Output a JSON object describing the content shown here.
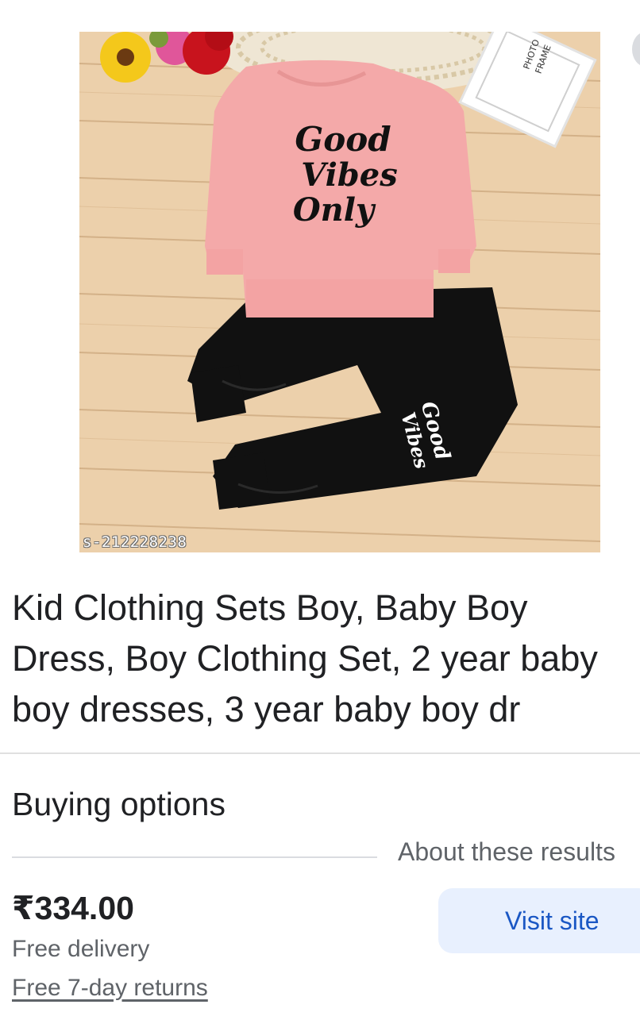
{
  "product": {
    "image_id": "s-212228238",
    "title": "Kid Clothing Sets Boy, Baby Boy Dress, Boy Clothing Set, 2 year baby boy dresses, 3 year baby boy dr",
    "shirt_print": [
      "Good",
      "Vibes",
      "Only"
    ],
    "pants_print": [
      "Good",
      "Vibes"
    ],
    "frame_print": [
      "PHOTO",
      "FRAME"
    ]
  },
  "buying_options": {
    "heading": "Buying options",
    "about_label": "About these results",
    "price": "₹334.00",
    "delivery": "Free delivery",
    "returns": "Free 7-day returns",
    "visit_label": "Visit site"
  },
  "colors": {
    "shirt": "#f4a9a9",
    "pants": "#111111",
    "wood": "#e9c9a3",
    "button_bg": "#e8f0fe",
    "button_text": "#1a57c4"
  }
}
